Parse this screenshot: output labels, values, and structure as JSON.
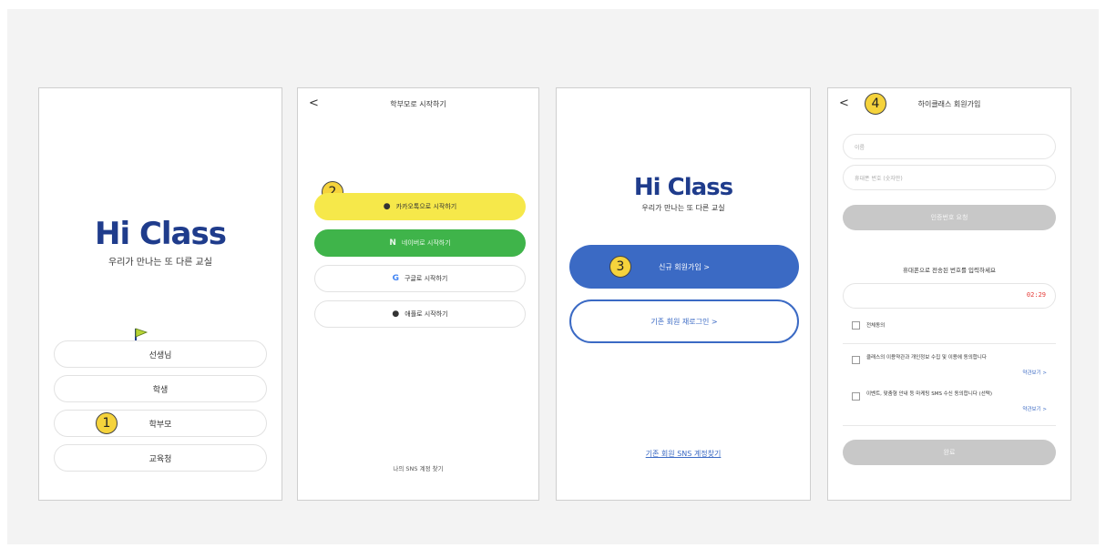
{
  "screens": {
    "s1": {
      "logo_word": "Hi Class",
      "logo_sub": "우리가 만나는 또 다른 교실",
      "roles": [
        "선생님",
        "학생",
        "학부모",
        "교육청"
      ],
      "badge": "1"
    },
    "s2": {
      "back": "<",
      "title": "학부모로 시작하기",
      "badge": "2",
      "buttons": {
        "kakao": "카카오톡으로 시작하기",
        "naver": "네이버로 시작하기",
        "google": "구글로 시작하기",
        "apple": "애플로 시작하기"
      },
      "icons": {
        "kakao": "kakao-icon",
        "naver": "naver-icon",
        "google": "google-icon",
        "apple": "apple-icon"
      },
      "find_link": "나의 SNS 계정 찾기"
    },
    "s3": {
      "logo_word": "Hi Class",
      "logo_sub": "우리가 만나는 또 다른 교실",
      "badge": "3",
      "signup": "신규 회원가입 >",
      "relogin": "기존 회원 재로그인 >",
      "sns_link": "기존 회원 SNS 계정찾기"
    },
    "s4": {
      "back": "<",
      "badge": "4",
      "title": "하이클래스 회원가입",
      "name_placeholder": "이름",
      "phone_placeholder": "휴대폰 번호 (숫자만)",
      "verify_button": "인증번호 요청",
      "notice": "휴대폰으로 전송된 번호를 입력하세요",
      "timer": "02:29",
      "agree_all": "전체동의",
      "terms1": "클래스의 이용약관과 개인정보 수집 및 이용에 동의합니다",
      "terms2": "이벤트, 맞춤형 안내 등 마케팅 SMS 수신 동의합니다 (선택)",
      "view_terms": "약관보기 >",
      "submit": "완료"
    }
  },
  "colors": {
    "brand_navy": "#1f3c8c",
    "primary_blue": "#3b6ac4",
    "kakao_yellow": "#f6e84a",
    "naver_green": "#3fb44a",
    "badge_yellow": "#f5d33c",
    "timer_red": "#e53935"
  }
}
